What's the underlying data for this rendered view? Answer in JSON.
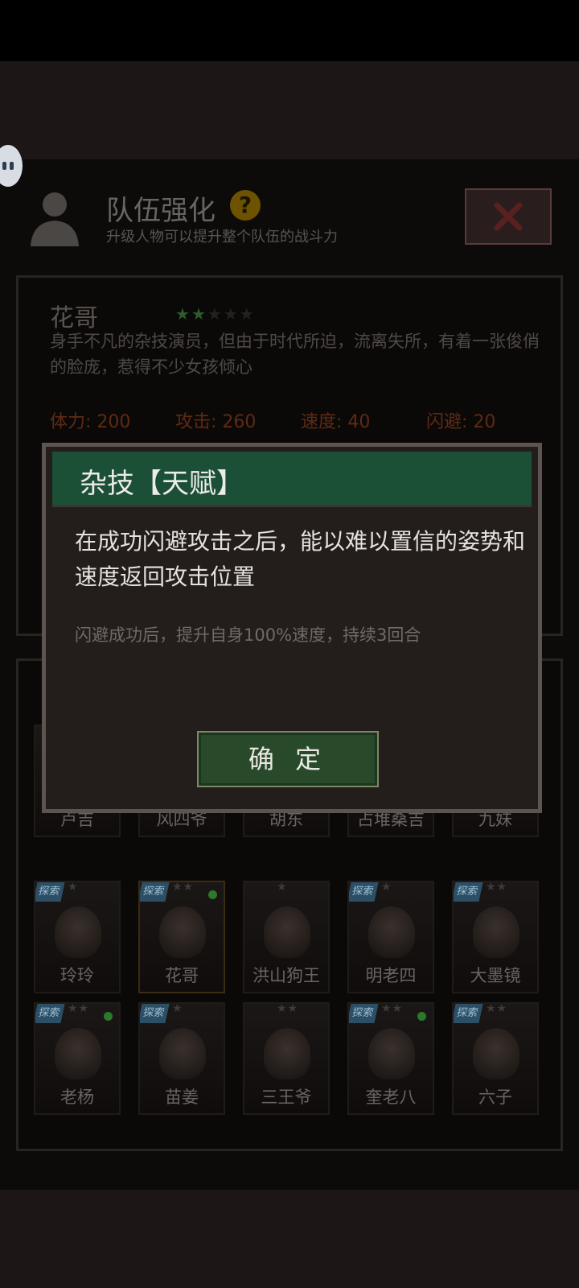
{
  "header": {
    "title": "队伍强化",
    "help": "?",
    "subtitle": "升级人物可以提升整个队伍的战斗力"
  },
  "hero": {
    "name": "花哥",
    "stars_filled": 2,
    "stars_total": 5,
    "description": "身手不凡的杂技演员，但由于时代所迫，流离失所，有着一张俊俏的脸庞，惹得不少女孩倾心",
    "stats": [
      {
        "label": "体力: 200"
      },
      {
        "label": "攻击: 260"
      },
      {
        "label": "速度: 40"
      },
      {
        "label": "闪避: 20"
      }
    ]
  },
  "modal": {
    "title": "杂技【天赋】",
    "text": "在成功闪避攻击之后，能以难以置信的姿势和速度返回攻击位置",
    "sub": "闪避成功后，提升自身100%速度，持续3回合",
    "confirm": "确 定"
  },
  "roster": [
    {
      "name": "卢吉"
    },
    {
      "name": "风四爷"
    },
    {
      "name": "胡东"
    },
    {
      "name": "占堆桑吉"
    },
    {
      "name": "九妹"
    },
    {
      "name": "玲玲",
      "badge": "探索",
      "stars": "★"
    },
    {
      "name": "花哥",
      "badge": "探索",
      "stars": "★★",
      "dot": true,
      "selected": true
    },
    {
      "name": "洪山狗王",
      "stars": "★"
    },
    {
      "name": "明老四",
      "badge": "探索",
      "stars": "★"
    },
    {
      "name": "大墨镜",
      "badge": "探索",
      "stars": "★★"
    },
    {
      "name": "老杨",
      "badge": "探索",
      "stars": "★★",
      "dot": true
    },
    {
      "name": "苗姜",
      "badge": "探索",
      "stars": "★"
    },
    {
      "name": "三王爷",
      "stars": "★★"
    },
    {
      "name": "奎老八",
      "badge": "探索",
      "stars": "★★",
      "dot": true
    },
    {
      "name": "六子",
      "badge": "探索",
      "stars": "★★"
    }
  ],
  "colors": {
    "modal_header": "#1c5036",
    "confirm_button": "#284a2b",
    "help_icon": "#6d5300",
    "status_dot": "#2a7a2a"
  }
}
